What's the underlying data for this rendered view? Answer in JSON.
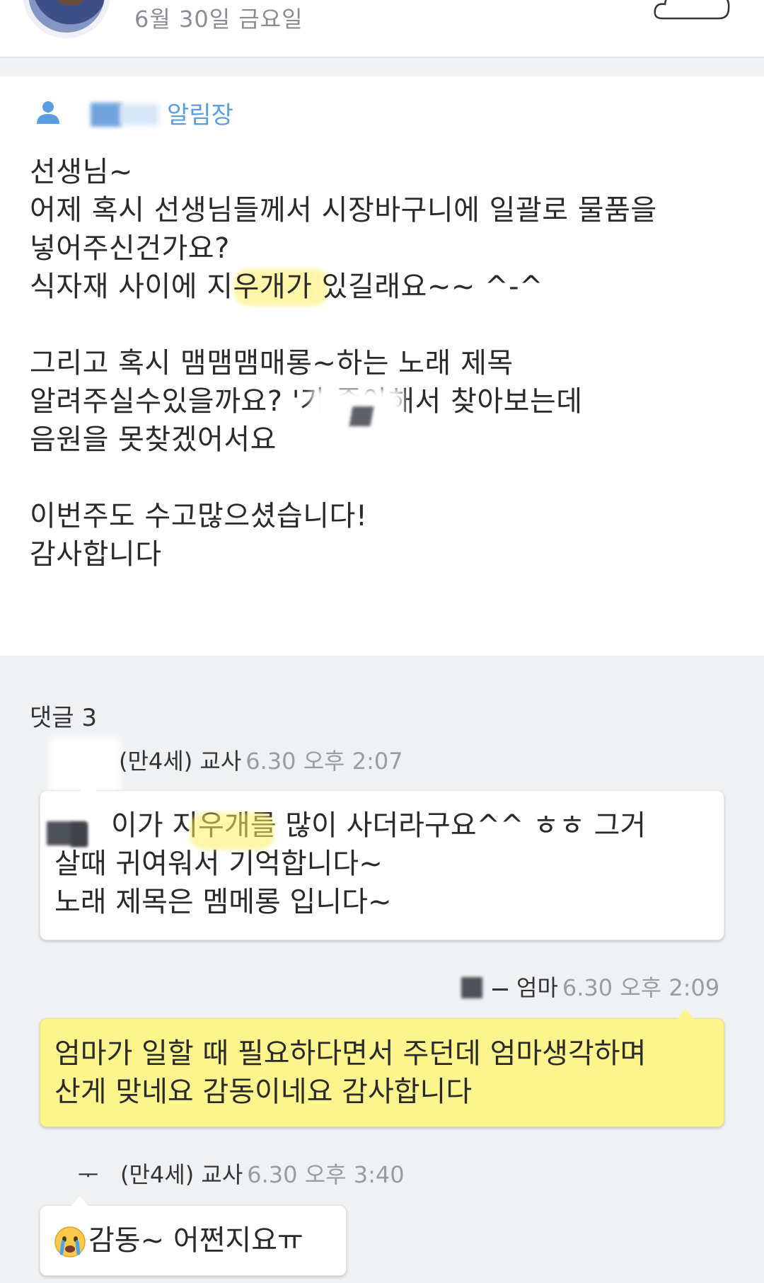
{
  "header": {
    "date": "6월 30일 금요일",
    "weather_icon": "cloud-icon"
  },
  "post": {
    "label": "알림장",
    "label_icon": "person-icon",
    "body_lines": [
      "선생님~",
      "어제 혹시 선생님들께서 시장바구니에 일괄로 물품을",
      "넣어주신건가요?",
      "식자재 사이에 지우개가 있길래요~~ ^-^",
      "",
      "그리고 혹시 맴맴맴매롱~하는 노래 제목",
      "알려주실수있을까요? '가 좋아해서 찾아보는데",
      "음원을 못찾겠어서요",
      "",
      "이번주도 수고많으셨습니다!",
      "감사합니다"
    ]
  },
  "comments": {
    "title": "댓글 3",
    "items": [
      {
        "author": "(만4세) 교사",
        "time": "6.30 오후 2:07",
        "lines": [
          "이가 지우개를 많이 사더라구요^^  ㅎㅎ 그거",
          "살때 귀여워서 기억합니다~",
          "노래 제목은 멤메롱 입니다~"
        ]
      },
      {
        "author": "엄마",
        "time": "6.30 오후 2:09",
        "lines": [
          "엄마가 일할 때 필요하다면서 주던데 엄마생각하며",
          "산게 맞네요 감동이네요 감사합니다"
        ]
      },
      {
        "author": "(만4세) 교사",
        "time": "6.30 오후 3:40",
        "lines": [
          "감동~  어쩐지요ㅠ"
        ]
      }
    ]
  },
  "colors": {
    "accent_blue": "#5a9ee0",
    "bubble_yellow": "#fcf48d",
    "background": "#f0f1f3"
  }
}
